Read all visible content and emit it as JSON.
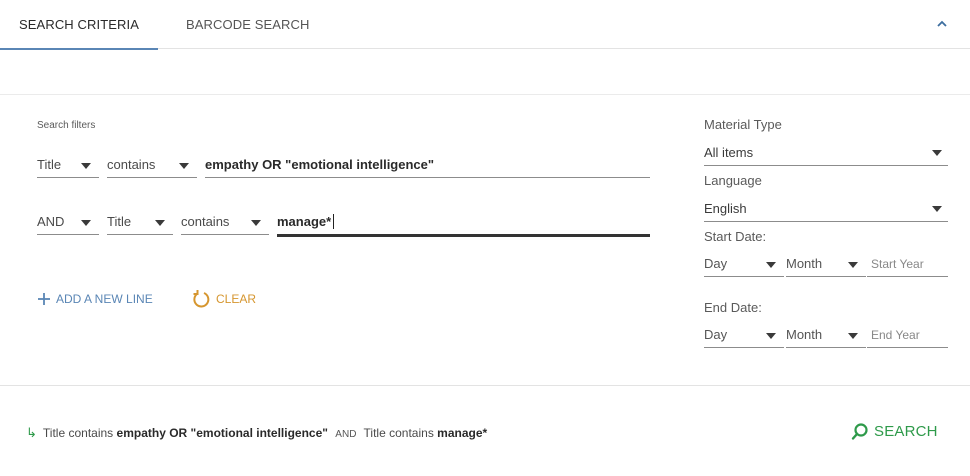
{
  "tabs": [
    {
      "label": "SEARCH CRITERIA",
      "active": true
    },
    {
      "label": "BARCODE SEARCH",
      "active": false
    }
  ],
  "filters": {
    "label": "Search filters",
    "line1": {
      "field": "Title",
      "operator": "contains",
      "value": "empathy OR \"emotional intelligence\""
    },
    "line2": {
      "boolean": "AND",
      "field": "Title",
      "operator": "contains",
      "value": "manage*"
    }
  },
  "actions": {
    "add_line": "ADD A NEW LINE",
    "clear": "CLEAR"
  },
  "right_panel": {
    "material_type_label": "Material Type",
    "material_type_value": "All items",
    "language_label": "Language",
    "language_value": "English",
    "start_date_label": "Start Date:",
    "start_day": "Day",
    "start_month": "Month",
    "start_year_placeholder": "Start Year",
    "end_date_label": "End Date:",
    "end_day": "Day",
    "end_month": "Month",
    "end_year_placeholder": "End Year"
  },
  "summary": {
    "field1": "Title",
    "op1": "contains",
    "value1": "empathy OR \"emotional intelligence\"",
    "boolean": "AND",
    "field2": "Title",
    "op2": "contains",
    "value2": "manage*"
  },
  "search_button": "SEARCH",
  "colors": {
    "tab_indicator": "#5a86b5",
    "add_line": "#5a86b5",
    "clear": "#d6962f",
    "search": "#2e9a4a"
  },
  "icons": {
    "collapse": "chevron-up-icon",
    "add": "plus-icon",
    "clear": "undo-icon",
    "search": "search-icon",
    "summary": "arrow-right-icon"
  }
}
